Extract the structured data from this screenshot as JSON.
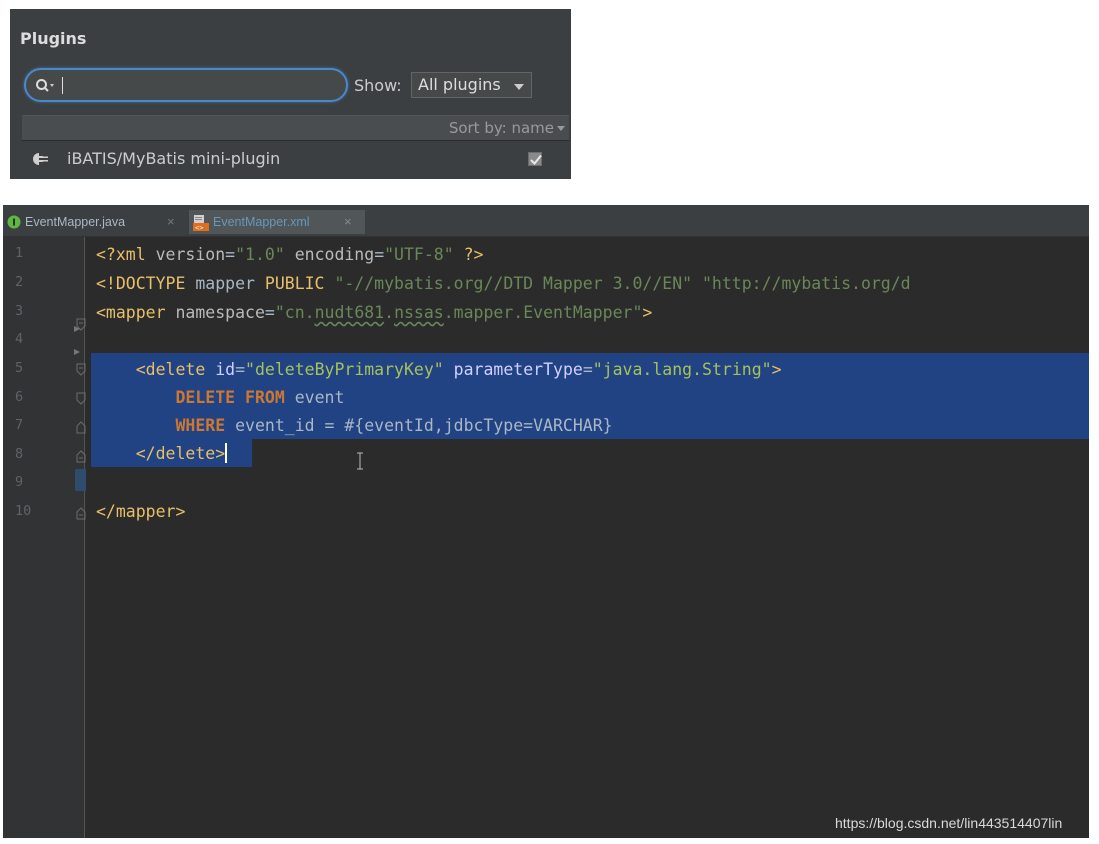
{
  "plugins": {
    "title": "Plugins",
    "search": {
      "value": "",
      "placeholder": ""
    },
    "show_label": "Show:",
    "show_selected": "All plugins",
    "sort_label": "Sort by: name",
    "items": [
      {
        "name": "iBATIS/MyBatis mini-plugin",
        "enabled": true
      }
    ]
  },
  "editor": {
    "tabs": [
      {
        "label": "EventMapper.java",
        "icon": "java-interface-icon",
        "active": false
      },
      {
        "label": "EventMapper.xml",
        "icon": "xml-file-icon",
        "active": true
      }
    ],
    "line_numbers": [
      "1",
      "2",
      "3",
      "4",
      "5",
      "6",
      "7",
      "8",
      "9",
      "10"
    ],
    "code": {
      "l1": {
        "open": "<?xml ",
        "attr1": "version",
        "eq1": "=",
        "val1": "\"1.0\"",
        "sp": " ",
        "attr2": "encoding",
        "eq2": "=",
        "val2": "\"UTF-8\"",
        "close": " ?>"
      },
      "l2": {
        "open": "<!DOCTYPE ",
        "t1": "mapper ",
        "kw": "PUBLIC",
        "sp": " ",
        "val1": "\"-//mybatis.org//DTD Mapper 3.0//EN\"",
        "sp2": " ",
        "val2": "\"http://mybatis.org/d"
      },
      "l3": {
        "open": "<mapper ",
        "attr": "namespace",
        "eq": "=",
        "q1": "\"cn.",
        "w1": "nudt681",
        "dot": ".",
        "w2": "nssas",
        "rest": ".mapper.EventMapper\"",
        "close": ">"
      },
      "l5": {
        "indent": "    ",
        "open": "<delete ",
        "attr1": "id",
        "eq1": "=",
        "val1": "\"deleteByPrimaryKey\"",
        "sp": " ",
        "attr2": "parameterType",
        "eq2": "=",
        "val2": "\"java.lang.String\"",
        "close": ">"
      },
      "l6": {
        "indent": "        ",
        "kw1": "DELETE",
        "sp": " ",
        "kw2": "FROM",
        "rest": " event"
      },
      "l7": {
        "indent": "        ",
        "kw": "WHERE",
        "rest": " event_id = #{eventId,jdbcType=VARCHAR}"
      },
      "l8": {
        "indent": "    ",
        "close": "</delete>"
      },
      "l10": {
        "close": "</mapper>"
      }
    }
  },
  "watermark": "https://blog.csdn.net/lin443514407lin",
  "colors": {
    "selection": "#214283",
    "tag": "#e8bf6a",
    "string": "#6a8759",
    "keyword": "#cc7832",
    "accent": "#4a88c7"
  }
}
